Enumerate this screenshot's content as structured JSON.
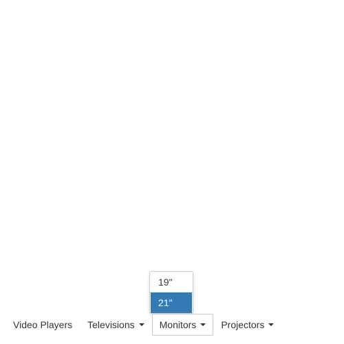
{
  "nav": {
    "items": [
      {
        "label": "Video Players",
        "has_caret": false
      },
      {
        "label": "Televisions",
        "has_caret": true
      },
      {
        "label": "Monitors",
        "has_caret": true,
        "open": true
      },
      {
        "label": "Projectors",
        "has_caret": true
      }
    ]
  },
  "dropdown": {
    "options": [
      "19\"",
      "21\""
    ],
    "selected": "21\""
  },
  "colors": {
    "accent": "#337ab7",
    "text": "#333333",
    "border": "#cccccc"
  }
}
